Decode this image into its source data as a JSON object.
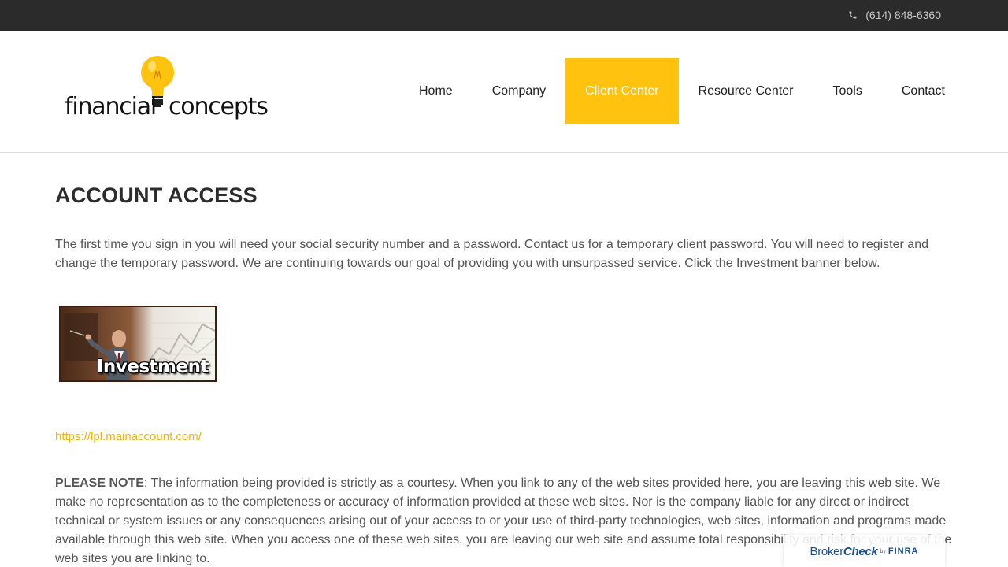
{
  "topbar": {
    "phone": "(614) 848-6360"
  },
  "logo": {
    "word_left": "financial",
    "word_right": "concepts"
  },
  "nav": {
    "items": [
      {
        "label": "Home"
      },
      {
        "label": "Company"
      },
      {
        "label": "Client Center",
        "active": true
      },
      {
        "label": "Resource Center"
      },
      {
        "label": "Tools"
      },
      {
        "label": "Contact"
      }
    ]
  },
  "main": {
    "title": "ACCOUNT ACCESS",
    "intro": "The first time you sign in you will need your social security number and a password.  Contact us for a temporary client password.  You will need to register and change the temporary password.  We are continuing towards our goal of providing you with unsurpassed service. Click the Investment banner below.",
    "banner_caption": "Investment",
    "link": "https://lpl.mainaccount.com/",
    "note_lead": "PLEASE NOTE",
    "note_body": ": The information being provided is strictly as a courtesy. When you link to any of the web sites provided here, you are leaving this web site. We make no representation as to the completeness or accuracy of information provided at these web sites. Nor is the company liable for any direct or indirect technical or system issues or any consequences arising out of your access to or your use of third-party technologies, web sites, information and programs made available through this web site. When you access one of these web sites, you are leaving our web site and assume total responsibility and risk for your use of the web sites you are linking to."
  },
  "brokercheck": {
    "broker": "Broker",
    "check": "Check",
    "by": "by",
    "finra": "FINRA"
  },
  "colors": {
    "accent": "#ffc20e",
    "topbar": "#2b2b2b",
    "link": "#f2b500"
  }
}
